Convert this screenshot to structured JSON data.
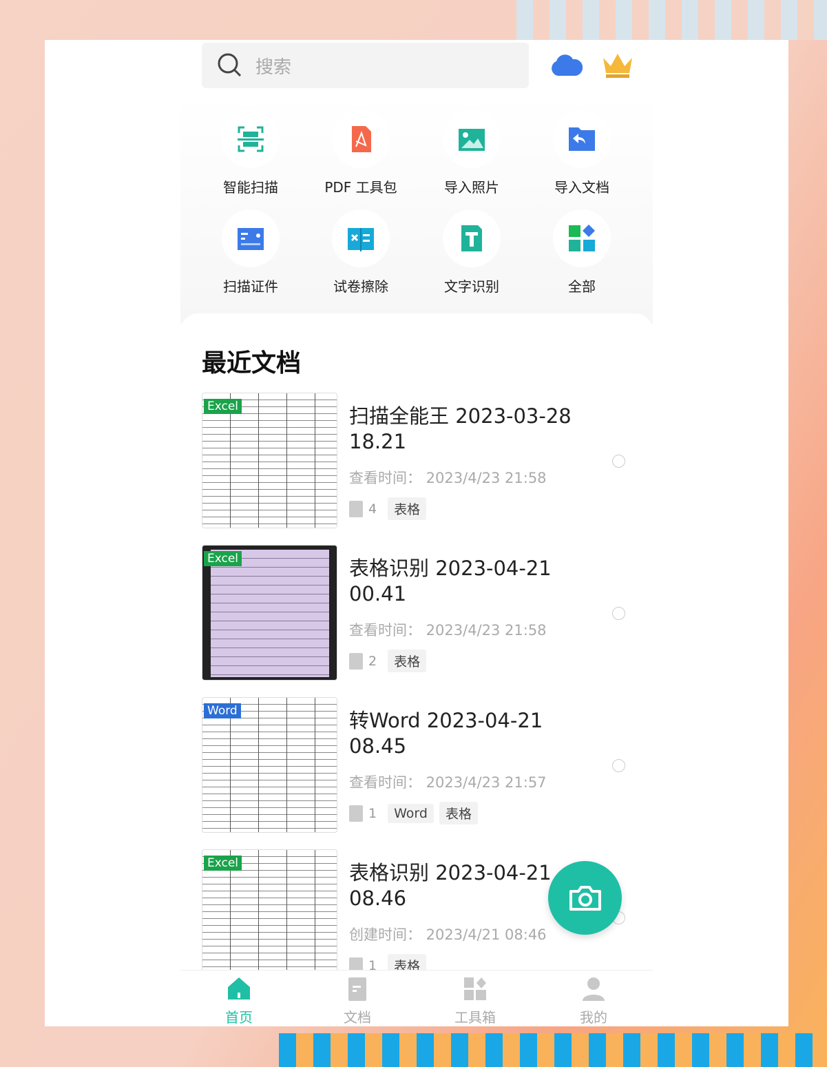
{
  "search": {
    "placeholder": "搜索"
  },
  "header": {
    "cloud_icon": "cloud-icon",
    "vip_icon": "crown-icon"
  },
  "tools": [
    {
      "label": "智能扫描",
      "icon": "scan-icon",
      "color": "#1fb39a"
    },
    {
      "label": "PDF 工具包",
      "icon": "pdf-icon",
      "color": "#f4694b"
    },
    {
      "label": "导入照片",
      "icon": "image-icon",
      "color": "#1fb39a"
    },
    {
      "label": "导入文档",
      "icon": "folder-import-icon",
      "color": "#3b7ae8"
    },
    {
      "label": "扫描证件",
      "icon": "id-card-icon",
      "color": "#3b7ae8"
    },
    {
      "label": "试卷擦除",
      "icon": "exam-erase-icon",
      "color": "#17a9d8"
    },
    {
      "label": "文字识别",
      "icon": "text-ocr-icon",
      "color": "#1fb39a"
    },
    {
      "label": "全部",
      "icon": "all-apps-icon",
      "color": "#1fb39a"
    }
  ],
  "recent": {
    "title": "最近文档",
    "items": [
      {
        "badge": "Excel",
        "title": "扫描全能王 2023-03-28 18.21",
        "time": "查看时间： 2023/4/23 21:58",
        "pages": "4",
        "tags": [
          "表格"
        ]
      },
      {
        "badge": "Excel",
        "title": "表格识别 2023-04-21 00.41",
        "time": "查看时间： 2023/4/23 21:58",
        "pages": "2",
        "tags": [
          "表格"
        ]
      },
      {
        "badge": "Word",
        "title": "转Word 2023-04-21 08.45",
        "time": "查看时间： 2023/4/23 21:57",
        "pages": "1",
        "tags": [
          "Word",
          "表格"
        ]
      },
      {
        "badge": "Excel",
        "title": "表格识别 2023-04-21 08.46",
        "time": "创建时间： 2023/4/21 08:46",
        "pages": "1",
        "tags": [
          "表格"
        ]
      }
    ]
  },
  "nav": [
    {
      "label": "首页",
      "active": true
    },
    {
      "label": "文档"
    },
    {
      "label": "工具箱"
    },
    {
      "label": "我的"
    }
  ],
  "colors": {
    "accent": "#1fbfa6"
  }
}
